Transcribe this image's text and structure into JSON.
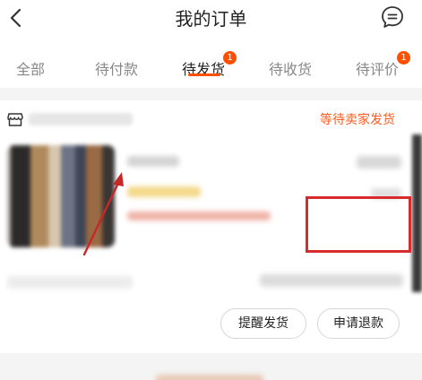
{
  "header": {
    "title": "我的订单",
    "back_icon": "chevron-left-icon",
    "message_icon": "chat-bubble-icon"
  },
  "tabs": [
    {
      "label": "全部",
      "badge": ""
    },
    {
      "label": "待付款",
      "badge": ""
    },
    {
      "label": "待发货",
      "badge": "1",
      "active": true
    },
    {
      "label": "待收货",
      "badge": ""
    },
    {
      "label": "待评价",
      "badge": "1"
    }
  ],
  "order": {
    "shop_icon": "shop-icon",
    "status": "等待卖家发货",
    "remind_button": "提醒发货",
    "refund_button": "申请退款"
  },
  "colors": {
    "accent": "#ff5000",
    "status_text": "#ff5a1f",
    "annotation_red": "#d92b2b"
  }
}
